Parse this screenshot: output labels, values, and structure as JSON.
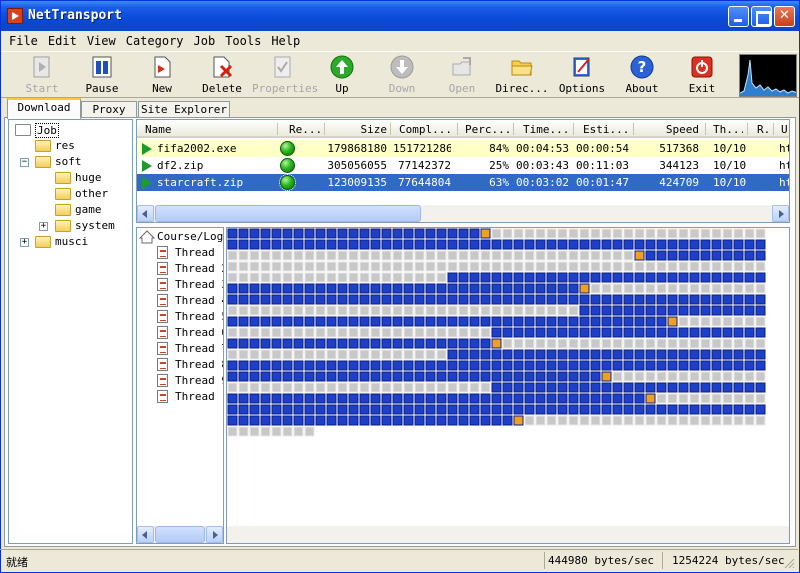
{
  "window": {
    "title": "NetTransport"
  },
  "menu": [
    "File",
    "Edit",
    "View",
    "Category",
    "Job",
    "Tools",
    "Help"
  ],
  "toolbar": [
    {
      "label": "Start",
      "icon": "start-icon",
      "enabled": false
    },
    {
      "label": "Pause",
      "icon": "pause-icon",
      "enabled": true
    },
    {
      "label": "New",
      "icon": "new-icon",
      "enabled": true
    },
    {
      "label": "Delete",
      "icon": "delete-icon",
      "enabled": true
    },
    {
      "label": "Properties",
      "icon": "properties-icon",
      "enabled": false
    },
    {
      "label": "Up",
      "icon": "up-arrow-icon",
      "enabled": true
    },
    {
      "label": "Down",
      "icon": "down-arrow-icon",
      "enabled": false
    },
    {
      "label": "Open",
      "icon": "open-icon",
      "enabled": false
    },
    {
      "label": "Direc...",
      "icon": "folder-icon",
      "enabled": true
    },
    {
      "label": "Options",
      "icon": "options-icon",
      "enabled": true
    },
    {
      "label": "About",
      "icon": "help-icon",
      "enabled": true
    },
    {
      "label": "Exit",
      "icon": "power-icon",
      "enabled": true
    }
  ],
  "tabs": [
    "Download",
    "Proxy",
    "Site Explorer"
  ],
  "tree": {
    "root": "Job",
    "items": [
      "res",
      "soft",
      "huge",
      "other",
      "game",
      "system",
      "musci"
    ]
  },
  "list": {
    "columns": [
      "Name",
      "Re...",
      "Size",
      "Compl...",
      "Perc...",
      "Time...",
      "Esti...",
      "Speed",
      "Th...",
      "R.",
      "U"
    ],
    "rows": [
      {
        "name": "fifa2002.exe",
        "size": "179868180",
        "completed": "151721286",
        "percent": "84%",
        "time": "00:04:53",
        "estimate": "00:00:54",
        "speed": "517368",
        "threads": "10/10",
        "url": "ht"
      },
      {
        "name": "df2.zip",
        "size": "305056055",
        "completed": "77142372",
        "percent": "25%",
        "time": "00:03:43",
        "estimate": "00:11:03",
        "speed": "344123",
        "threads": "10/10",
        "url": "ht"
      },
      {
        "name": "starcraft.zip",
        "size": "123009135",
        "completed": "77644804",
        "percent": "63%",
        "time": "00:03:02",
        "estimate": "00:01:47",
        "speed": "424709",
        "threads": "10/10",
        "url": "ht"
      }
    ],
    "selected_row": 2
  },
  "threads": {
    "root": "Course/Log",
    "items": [
      "Thread",
      "Thread 2",
      "Thread 3",
      "Thread 4",
      "Thread 5",
      "Thread 6",
      "Thread 7",
      "Thread 8",
      "Thread 9",
      "Thread"
    ]
  },
  "status": {
    "left": "就绪",
    "speed1": "444980 bytes/sec",
    "speed2": "1254224 bytes/sec"
  },
  "colors": {
    "done": "#1e3fc8",
    "pending": "#c8c8c8",
    "active": "#f0a020",
    "selection": "#316ac5"
  }
}
